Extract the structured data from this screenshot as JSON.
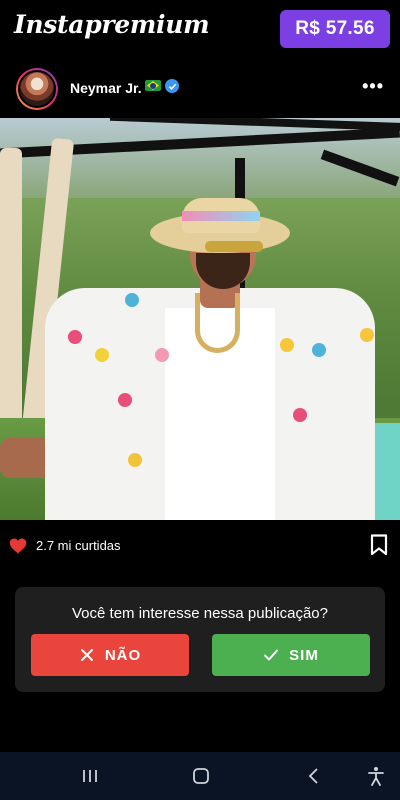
{
  "header": {
    "brand": "Instapremium",
    "balance": "R$ 57.56"
  },
  "post": {
    "username": "Neymar Jr.",
    "flag_icon": "brazil-flag-icon",
    "verified_icon": "verified-badge-icon",
    "more_icon": "more-options-icon",
    "more_symbol": "•••",
    "likes_text": "2.7 mi curtidas",
    "like_icon": "heart-icon",
    "save_icon": "bookmark-icon"
  },
  "prompt": {
    "question": "Você tem interesse nessa publicação?",
    "no_label": "NÃO",
    "yes_label": "SIM"
  },
  "system_nav": {
    "icons": [
      "recent-apps-icon",
      "home-icon",
      "back-icon",
      "accessibility-icon"
    ]
  },
  "colors": {
    "balance_bg": "#7b3fe4",
    "no_button": "#e9453d",
    "yes_button": "#4caf50",
    "heart": "#e53935",
    "card_bg": "#1f1f1f",
    "navbar_bg": "#0b1424"
  }
}
